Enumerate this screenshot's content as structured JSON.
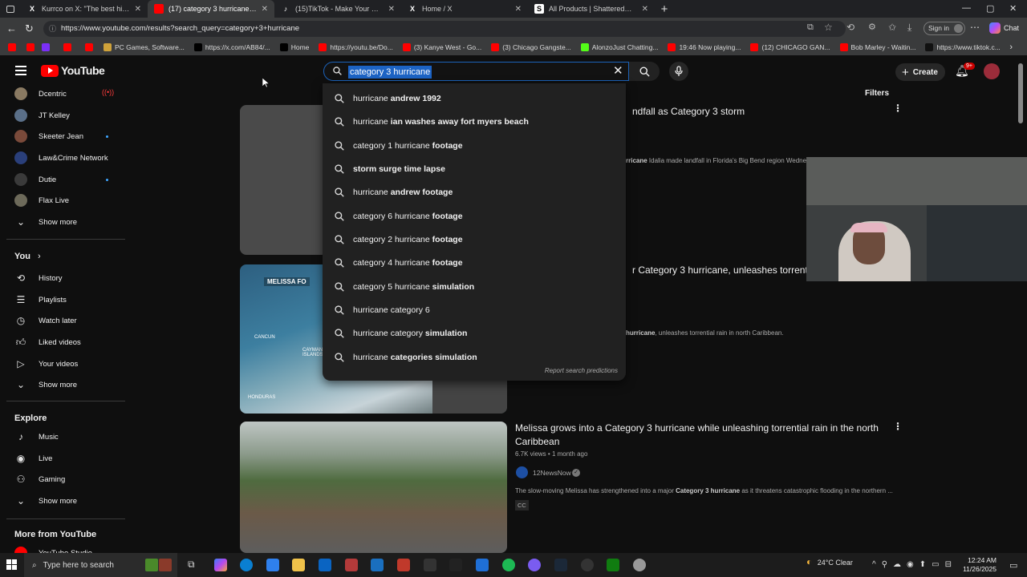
{
  "browser": {
    "tabs": [
      {
        "title": "Kurrco on X: \"The best hip-hop a",
        "favicon": "X",
        "active": false
      },
      {
        "title": "(17) category 3 hurricane - YouTu",
        "favicon": "yt",
        "active": true
      },
      {
        "title": "(15)TikTok - Make Your Day",
        "favicon": "tt",
        "active": false
      },
      {
        "title": "Home / X",
        "favicon": "X",
        "active": false
      },
      {
        "title": "All Products | ShatteredClique",
        "favicon": "S",
        "active": false
      }
    ],
    "url": "https://www.youtube.com/results?search_query=category+3+hurricane",
    "signin_label": "Sign in",
    "chat_label": "Chat",
    "bookmarks": [
      {
        "label": "PC Games, Software...",
        "color": "#cfa23a"
      },
      {
        "label": "https://x.com/AB84/...",
        "color": "#000000"
      },
      {
        "label": "Home",
        "color": "#000000"
      },
      {
        "label": "https://youtu.be/Do...",
        "color": "#ff0000"
      },
      {
        "label": "(3) Kanye West - Go...",
        "color": "#ff0000"
      },
      {
        "label": "(3) Chicago Gangste...",
        "color": "#ff0000"
      },
      {
        "label": "AlonzoJust Chatting...",
        "color": "#53fc18"
      },
      {
        "label": "19:46 Now playing...",
        "color": "#ff0000"
      },
      {
        "label": "(12) CHICAGO GAN...",
        "color": "#ff0000"
      },
      {
        "label": "Bob Marley - Waitin...",
        "color": "#ff0000"
      },
      {
        "label": "https://www.tiktok.c...",
        "color": "#111111"
      }
    ]
  },
  "youtube": {
    "logo": "YouTube",
    "search_value": "category 3 hurricane",
    "create_label": "Create",
    "notif_badge": "9+",
    "filters_label": "Filters",
    "subscriptions": [
      {
        "name": "Dcentric",
        "live": true,
        "new": false,
        "color": "#8a7a62"
      },
      {
        "name": "JT Kelley",
        "live": false,
        "new": false,
        "color": "#5a6f88"
      },
      {
        "name": "Skeeter Jean",
        "live": false,
        "new": true,
        "color": "#7a4a3a"
      },
      {
        "name": "Law&Crime Network",
        "live": false,
        "new": false,
        "color": "#2a3f7a"
      },
      {
        "name": "Dutie",
        "live": false,
        "new": true,
        "color": "#3a3a3a"
      },
      {
        "name": "Flax Live",
        "live": false,
        "new": false,
        "color": "#6d6a5a"
      }
    ],
    "show_more": "Show more",
    "you_header": "You",
    "you_items": [
      {
        "label": "History",
        "icon": "history-icon"
      },
      {
        "label": "Playlists",
        "icon": "playlists-icon"
      },
      {
        "label": "Watch later",
        "icon": "watch-later-icon"
      },
      {
        "label": "Liked videos",
        "icon": "like-icon"
      },
      {
        "label": "Your videos",
        "icon": "your-videos-icon"
      }
    ],
    "explore_header": "Explore",
    "explore_items": [
      {
        "label": "Music",
        "icon": "music-icon"
      },
      {
        "label": "Live",
        "icon": "live-icon"
      },
      {
        "label": "Gaming",
        "icon": "gaming-icon"
      }
    ],
    "more_header": "More from YouTube",
    "studio_label": "YouTube Studio",
    "suggestions": [
      {
        "prefix": "hurricane ",
        "bold": "andrew 1992"
      },
      {
        "prefix": "hurricane ",
        "bold": "ian washes away fort myers beach"
      },
      {
        "prefix": "category 1 hurricane ",
        "bold": "footage"
      },
      {
        "prefix": "",
        "bold": "storm surge time lapse"
      },
      {
        "prefix": "hurricane ",
        "bold": "andrew footage"
      },
      {
        "prefix": "category 6 hurricane ",
        "bold": "footage"
      },
      {
        "prefix": "category 2 hurricane ",
        "bold": "footage"
      },
      {
        "prefix": "category 4 hurricane ",
        "bold": "footage"
      },
      {
        "prefix": "category 5 hurricane ",
        "bold": "simulation"
      },
      {
        "prefix": "hurricane category 6",
        "bold": ""
      },
      {
        "prefix": "hurricane category ",
        "bold": "simulation"
      },
      {
        "prefix": "hurricane ",
        "bold": "categories simulation"
      }
    ],
    "report_label": "Report search predictions",
    "videos": [
      {
        "title_visible": "ndfall as Category 3 storm",
        "desc_pre": "rricane",
        "desc_rest": " Idalia made landfall in Florida's Big Bend region Wednes"
      },
      {
        "title_visible": "r Category 3 hurricane, unleashes torrential",
        "thumb_label": "MELISSA FO",
        "map_labels": [
          "CANCUN",
          "CAYMAN ISLANDS",
          "HONDURAS"
        ],
        "desc_bold": "hurricane",
        "desc_rest": ", unleashes torrential rain in north Caribbean."
      },
      {
        "title": "Melissa grows into a Category 3 hurricane while unleashing torrential rain in the north Caribbean",
        "views": "6.7K views",
        "age": "1 month ago",
        "channel": "12NewsNow",
        "desc_pre": "The slow-moving Melissa has strengthened into a major ",
        "desc_bold": "Category 3 hurricane",
        "desc_rest": " as it threatens catastrophic flooding in the northern ...",
        "badge": "CC"
      }
    ]
  },
  "taskbar": {
    "search_placeholder": "Type here to search",
    "weather": "24°C  Clear",
    "time": "12:24 AM",
    "date": "11/26/2025"
  }
}
